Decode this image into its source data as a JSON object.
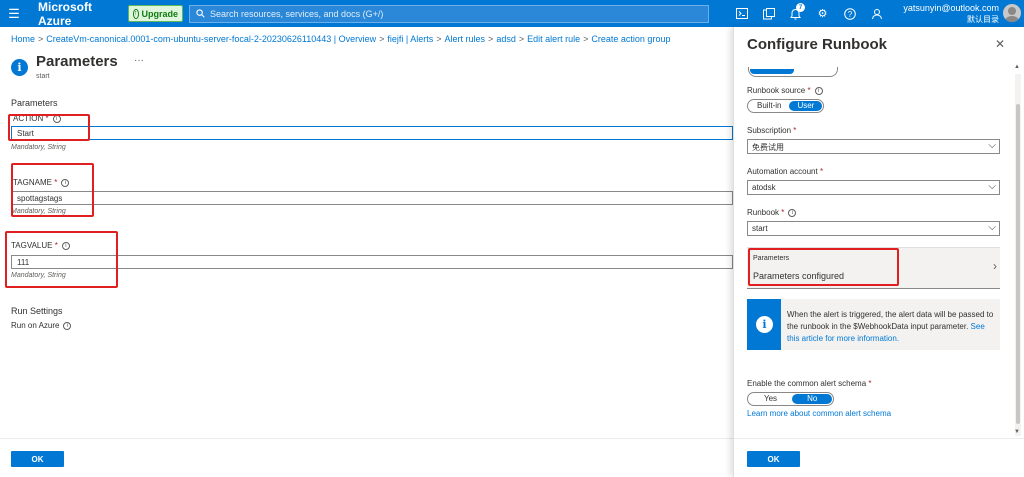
{
  "topbar": {
    "brand": "Microsoft Azure",
    "upgrade_label": "Upgrade",
    "search_placeholder": "Search resources, services, and docs (G+/)",
    "notification_count": "7",
    "account_email": "yatsunyin@outlook.com",
    "account_directory": "默认目录",
    "icons": [
      "cloud-shell-icon",
      "directory-filter-icon",
      "notifications-icon",
      "settings-icon",
      "help-icon",
      "feedback-icon"
    ]
  },
  "breadcrumb": [
    "Home",
    "CreateVm-canonical.0001-com-ubuntu-server-focal-2-20230626110443 | Overview",
    "fiejfi | Alerts",
    "Alert rules",
    "adsd",
    "Edit alert rule",
    "Create action group"
  ],
  "page": {
    "title": "Parameters",
    "subtitle": "start"
  },
  "form": {
    "section_title": "Parameters",
    "fields": [
      {
        "label": "ACTION",
        "value": "Start",
        "hint": "Mandatory, String"
      },
      {
        "label": "TAGNAME",
        "value": "spottagstags",
        "hint": "Mandatory, String"
      },
      {
        "label": "TAGVALUE",
        "value": "111",
        "hint": "Mandatory, String"
      }
    ],
    "run_settings_title": "Run Settings",
    "run_on_label": "Run on Azure",
    "ok_label": "OK"
  },
  "panel": {
    "title": "Configure Runbook",
    "runbook_source_label": "Runbook source",
    "runbook_source_options": [
      "Built-in",
      "User"
    ],
    "runbook_source_selected": "User",
    "subscription_label": "Subscription",
    "subscription_value": "免费试用",
    "automation_account_label": "Automation account",
    "automation_account_value": "atodsk",
    "runbook_label": "Runbook",
    "runbook_value": "start",
    "parameters_label": "Parameters",
    "parameters_value": "Parameters configured",
    "info_text": "When the alert is triggered, the alert data will be passed to the runbook in the $WebhookData input parameter.",
    "info_link": "See this article for more information.",
    "common_schema_label": "Enable the common alert schema",
    "common_schema_options": [
      "Yes",
      "No"
    ],
    "common_schema_selected": "No",
    "common_schema_link": "Learn more about common alert schema",
    "ok_label": "OK"
  },
  "colors": {
    "azure_blue": "#0078d4",
    "highlight_red": "#e02020"
  }
}
